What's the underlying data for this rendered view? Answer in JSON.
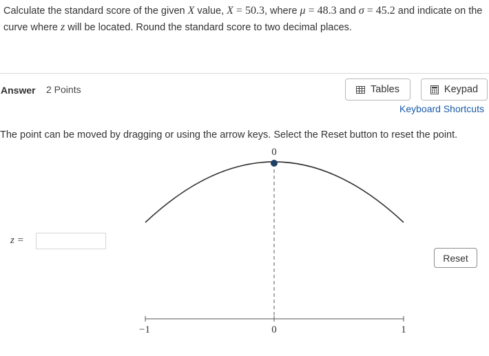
{
  "question": {
    "p1": "Calculate the standard score of the given ",
    "x_var": "X",
    "p2": " value, ",
    "x_eq": "X",
    "x_val": " = 50.3",
    "p3": ", where ",
    "mu": "μ",
    "mu_val": " = 48.3",
    "p4": " and ",
    "sigma": "σ",
    "sigma_val": " = 45.2",
    "p5": " and indicate on the curve where ",
    "z_var": "z",
    "p6": " will be located. Round the standard score to two decimal places."
  },
  "answer": {
    "label": "Answer",
    "points": "2 Points"
  },
  "toolbar": {
    "tables_label": "Tables",
    "keypad_label": "Keypad",
    "keyboard_shortcuts": "Keyboard Shortcuts"
  },
  "instruction": "The point can be moved by dragging or using the arrow keys. Select the Reset button to reset the point.",
  "z_input": {
    "label": "z =",
    "value": ""
  },
  "reset_label": "Reset",
  "graph": {
    "point_value_label": "0",
    "axis_ticks": [
      "−1",
      "0",
      "1"
    ],
    "point_z": 0,
    "colors": {
      "point": "#1f3f66",
      "curve": "#333333",
      "dashed": "#555555"
    }
  }
}
